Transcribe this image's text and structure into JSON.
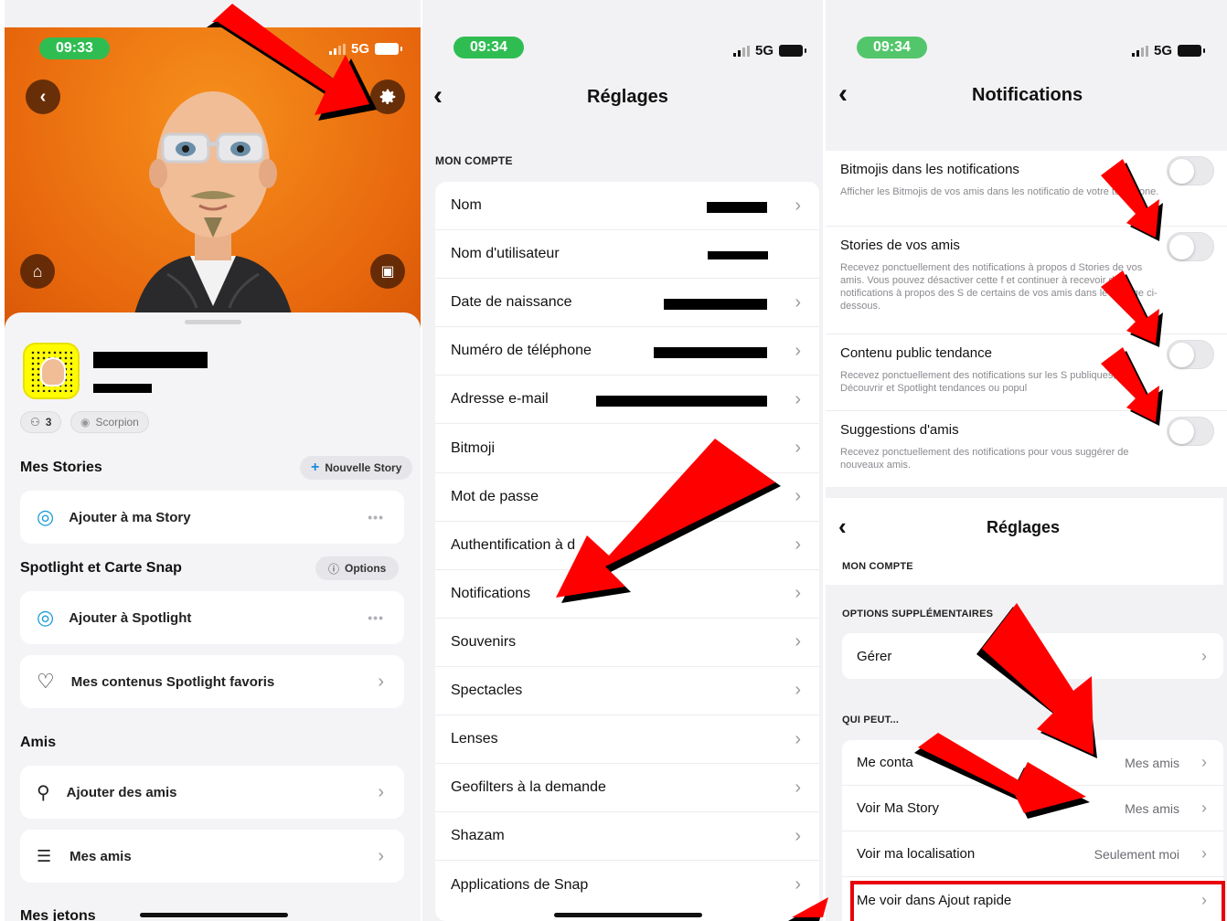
{
  "panel1": {
    "status": {
      "time": "09:33",
      "network": "5G"
    },
    "icons": {
      "back": "chevron-left-icon",
      "settings": "gear-icon",
      "wardrobe": "hanger-icon",
      "photo": "image-icon"
    },
    "username_rank": "3",
    "zodiac": "Scorpion",
    "stories": {
      "title": "Mes Stories",
      "new_story_label": "Nouvelle Story",
      "add_story": "Ajouter à ma Story"
    },
    "spotlight": {
      "title": "Spotlight et Carte Snap",
      "options_label": "Options",
      "add_spotlight": "Ajouter à Spotlight",
      "favorites": "Mes contenus Spotlight favoris"
    },
    "friends": {
      "title": "Amis",
      "add_friends": "Ajouter des amis",
      "my_friends": "Mes amis"
    },
    "tokens_title": "Mes jetons"
  },
  "panel2": {
    "status": {
      "time": "09:34",
      "network": "5G"
    },
    "title": "Réglages",
    "section": "MON COMPTE",
    "rows": [
      {
        "label": "Nom"
      },
      {
        "label": "Nom d'utilisateur"
      },
      {
        "label": "Date de naissance"
      },
      {
        "label": "Numéro de téléphone"
      },
      {
        "label": "Adresse e-mail"
      },
      {
        "label": "Bitmoji"
      },
      {
        "label": "Mot de passe"
      },
      {
        "label": "Authentification à d"
      },
      {
        "label": "Notifications"
      },
      {
        "label": "Souvenirs"
      },
      {
        "label": "Spectacles"
      },
      {
        "label": "Lenses"
      },
      {
        "label": "Geofilters à la demande"
      },
      {
        "label": "Shazam"
      },
      {
        "label": "Applications de Snap"
      }
    ]
  },
  "panel3": {
    "status": {
      "time": "09:34",
      "network": "5G"
    },
    "title": "Notifications",
    "notifications": [
      {
        "title": "Bitmojis dans les notifications",
        "desc": "Afficher les Bitmojis de vos amis dans les notificatio de votre téléphone.",
        "enabled": false
      },
      {
        "title": "Stories de vos amis",
        "desc": "Recevez ponctuellement des notifications à propos d Stories de vos amis. Vous pouvez désactiver cette f et continuer à recevoir des notifications à propos des S de certains de vos amis dans le réglage ci-dessous.",
        "enabled": false
      },
      {
        "title": "Contenu public tendance",
        "desc": "Recevez ponctuellement des notifications sur les S publiques, Découvrir et Spotlight tendances ou popul",
        "enabled": false
      },
      {
        "title": "Suggestions d'amis",
        "desc": "Recevez ponctuellement des notifications pour vous suggérer de nouveaux amis.",
        "enabled": false
      }
    ],
    "settings_title": "Réglages",
    "section_account": "MON COMPTE",
    "section_options": "OPTIONS SUPPLÉMENTAIRES",
    "manage": "Gérer",
    "section_who": "QUI PEUT...",
    "who_rows": [
      {
        "label": "Me conta",
        "value": "Mes amis"
      },
      {
        "label": "Voir Ma Story",
        "value": "Mes amis"
      },
      {
        "label": "Voir ma localisation",
        "value": "Seulement moi"
      },
      {
        "label": "Me voir dans Ajout rapide",
        "value": ""
      }
    ]
  },
  "colors": {
    "status_green": "#2fbd52",
    "snap_orange": "#f08418",
    "arrow_red": "#ff0000",
    "highlight_red": "#e8000b"
  }
}
